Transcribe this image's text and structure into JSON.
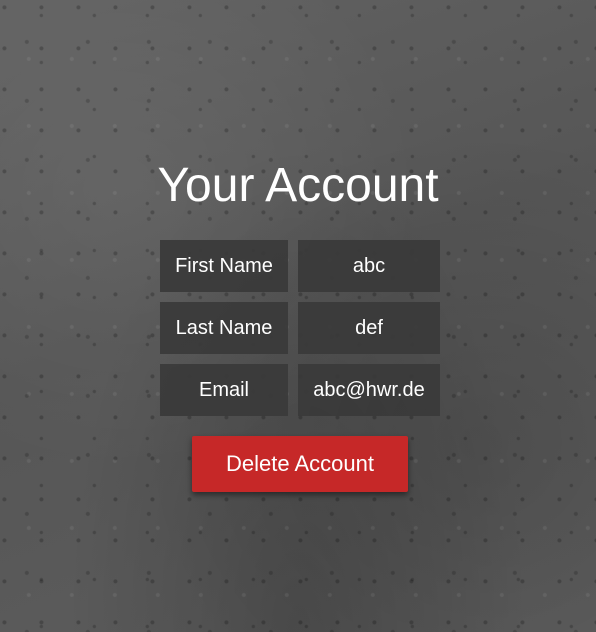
{
  "page": {
    "title": "Your Account"
  },
  "account": {
    "rows": [
      {
        "label": "First Name",
        "value": "abc"
      },
      {
        "label": "Last Name",
        "value": "def"
      },
      {
        "label": "Email",
        "value": "abc@hwr.de"
      }
    ]
  },
  "actions": {
    "delete_label": "Delete Account"
  },
  "colors": {
    "danger": "#c62828",
    "cell_background": "#3a3a3a",
    "background": "#5a5a5a",
    "text": "#ffffff"
  }
}
